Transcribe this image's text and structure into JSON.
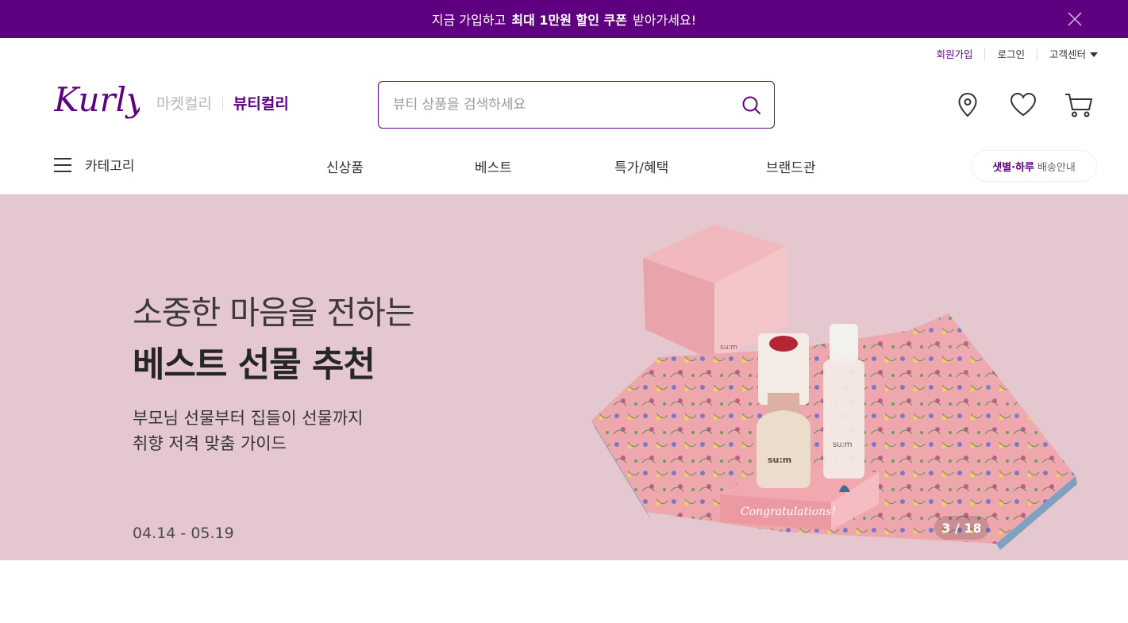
{
  "promo": {
    "text_before": "지금 가입하고",
    "text_bold": "최대 1만원 할인 쿠폰",
    "text_after": "받아가세요!",
    "close_icon": "close-icon"
  },
  "util_links": {
    "signup": "회원가입",
    "login": "로그인",
    "customer_center": "고객센터"
  },
  "brand": {
    "logo_text": "Kurly",
    "tab_market": "마켓컬리",
    "tab_beauty": "뷰티컬리",
    "color": "#5f0080"
  },
  "search": {
    "placeholder": "뷰티 상품을 검색하세요",
    "icon": "search-icon"
  },
  "header_icons": [
    "location-icon",
    "heart-icon",
    "cart-icon"
  ],
  "nav": {
    "category_label": "카테고리",
    "items": [
      "신상품",
      "베스트",
      "특가/혜택",
      "브랜드관"
    ],
    "delivery_bold": "샛별·하루",
    "delivery_rest": "배송안내"
  },
  "banner": {
    "line1": "소중한 마음을 전하는",
    "line2": "베스트 선물 추천",
    "sub1": "부모님 선물부터 집들이 선물까지",
    "sub2": "취향 저격 맞춤 가이드",
    "date": "04.14 - 05.19",
    "product_brand": "su:m",
    "box_text": "Congratulations!",
    "background": "#e5c7cf"
  },
  "pager": {
    "text": "3 / 18"
  }
}
